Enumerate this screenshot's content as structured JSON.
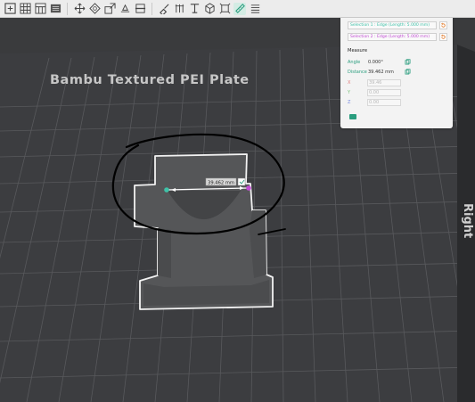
{
  "toolbar": {
    "tools": [
      "add-icon",
      "grid-icon",
      "layout-icon",
      "plate-icon",
      "move-icon",
      "rotate-icon",
      "scale-icon",
      "lay-flat-icon",
      "cut-icon",
      "support-paint-icon",
      "seam-paint-icon",
      "text-icon",
      "box-icon",
      "assembly-icon",
      "measure-icon",
      "variable-layer-icon"
    ]
  },
  "plate": {
    "name": "Bambu Textured PEI Plate",
    "side_label": "Right"
  },
  "measurement": {
    "label": "39.462 mm"
  },
  "panel": {
    "selection1": "Selection 1 : Edge (Length: 5.000 mm)",
    "selection2": "Selection 2 : Edge (Length: 5.000 mm)",
    "measure_title": "Measure",
    "angle_label": "Angle",
    "angle_value": "0.000°",
    "distance_label": "Distance",
    "distance_value": "39.462 mm",
    "x_label": "X",
    "x_value": "39.46",
    "y_label": "Y",
    "y_value": "0.00",
    "z_label": "Z",
    "z_value": "0.00"
  },
  "colors": {
    "toolbar_bg": "#ececec",
    "plate": "#3a3b3d",
    "grid": "#5a5b5e",
    "model": "#555658",
    "selection1": "#3ec2a8",
    "selection2": "#c24bd4",
    "annotation": "#000000",
    "panel_bg": "#f3f3f3"
  }
}
